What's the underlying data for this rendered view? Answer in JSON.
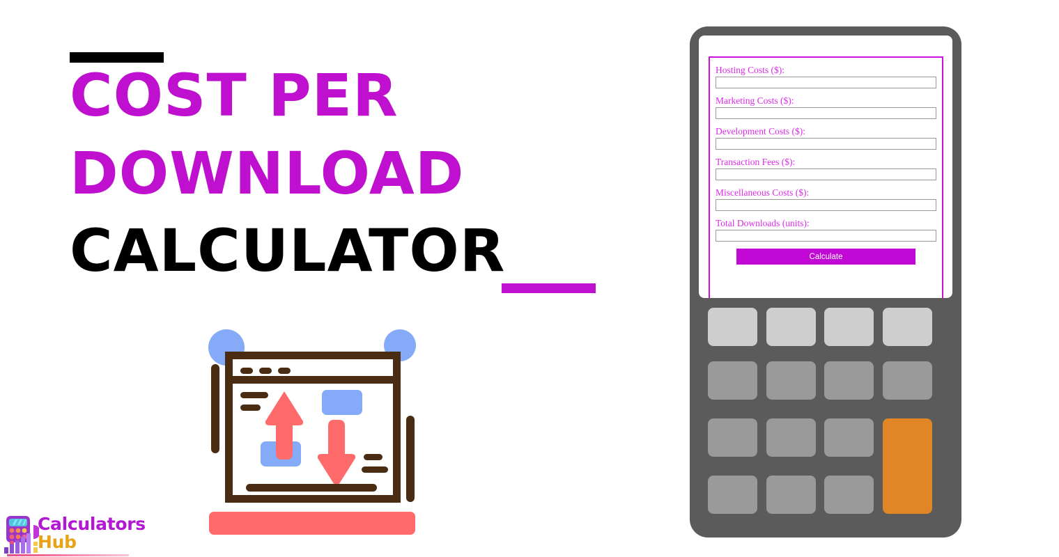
{
  "title": {
    "line1": "COST PER",
    "line2": "DOWNLOAD",
    "line3": "CALCULATOR"
  },
  "colors": {
    "accent_magenta": "#BF10CF",
    "title_black": "#000000",
    "illustration_brown": "#4A2C13",
    "illustration_blue": "#85AAF7",
    "illustration_coral": "#FF6B6B",
    "calculator_body": "#5B5B5B",
    "key_light": "#CECECE",
    "key_mid": "#9A9A9A",
    "key_accent": "#E08626",
    "form_border": "#CB11D8",
    "form_label": "#DD2BE8",
    "button_bg": "#C208D4"
  },
  "logo": {
    "word1": "Calculators",
    "word2": "Hub",
    "icon": "calculator-bar-chart-icon"
  },
  "illustration": {
    "icon": "upload-download-browser-window-icon"
  },
  "calculator": {
    "form": {
      "fields": [
        {
          "label": "Hosting Costs ($):",
          "value": "",
          "placeholder": ""
        },
        {
          "label": "Marketing Costs ($):",
          "value": "",
          "placeholder": ""
        },
        {
          "label": "Development Costs ($):",
          "value": "",
          "placeholder": ""
        },
        {
          "label": "Transaction Fees ($):",
          "value": "",
          "placeholder": ""
        },
        {
          "label": "Miscellaneous Costs ($):",
          "value": "",
          "placeholder": ""
        },
        {
          "label": "Total Downloads (units):",
          "value": "",
          "placeholder": ""
        }
      ],
      "submit_label": "Calculate"
    },
    "keypad": {
      "rows": 4,
      "cols": 4,
      "keys": [
        {
          "style": "light"
        },
        {
          "style": "light"
        },
        {
          "style": "light"
        },
        {
          "style": "light"
        },
        {
          "style": "mid"
        },
        {
          "style": "mid"
        },
        {
          "style": "mid"
        },
        {
          "style": "mid"
        },
        {
          "style": "mid"
        },
        {
          "style": "mid"
        },
        {
          "style": "mid"
        },
        {
          "style": "accent",
          "tall": true
        },
        {
          "style": "mid"
        },
        {
          "style": "mid"
        },
        {
          "style": "mid"
        }
      ]
    }
  }
}
